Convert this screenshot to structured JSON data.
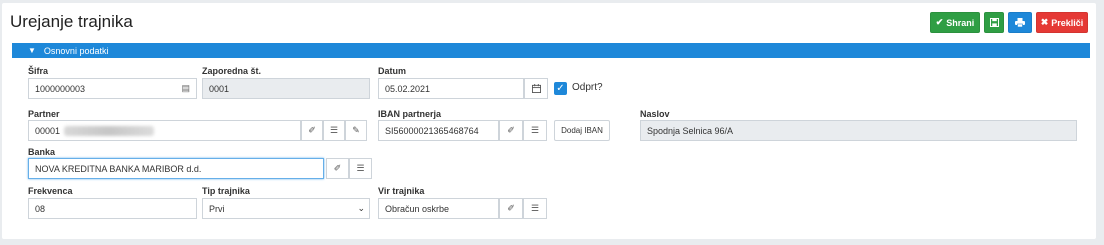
{
  "page": {
    "title": "Urejanje trajnika"
  },
  "toolbar": {
    "save_label": "Shrani",
    "cancel_label": "Prekliči"
  },
  "section": {
    "title": "Osnovni podatki"
  },
  "form": {
    "sifra": {
      "label": "Šifra",
      "value": "1000000003"
    },
    "zaporedna": {
      "label": "Zaporedna št.",
      "value": "0001"
    },
    "datum": {
      "label": "Datum",
      "value": "05.02.2021"
    },
    "odprt": {
      "label": "Odprt?",
      "checked": true
    },
    "partner": {
      "label": "Partner",
      "value": "00001"
    },
    "iban": {
      "label": "IBAN partnerja",
      "value": "SI56000021365468764",
      "add_button": "Dodaj IBAN"
    },
    "naslov": {
      "label": "Naslov",
      "value": "Spodnja Selnica 96/A"
    },
    "banka": {
      "label": "Banka",
      "value": "NOVA KREDITNA BANKA MARIBOR d.d."
    },
    "frekvenca": {
      "label": "Frekvenca",
      "value": "08"
    },
    "tip": {
      "label": "Tip trajnika",
      "value": "Prvi"
    },
    "vir": {
      "label": "Vir trajnika",
      "value": "Obračun oskrbe"
    }
  },
  "colors": {
    "primary": "#1e88d9",
    "success": "#2f9e44",
    "danger": "#e53935"
  },
  "icons": [
    "check-icon",
    "save-icon",
    "print-icon",
    "close-icon",
    "chevron-down-icon",
    "lookup-icon",
    "calendar-icon",
    "eraser-icon",
    "list-icon",
    "pencil-icon"
  ]
}
